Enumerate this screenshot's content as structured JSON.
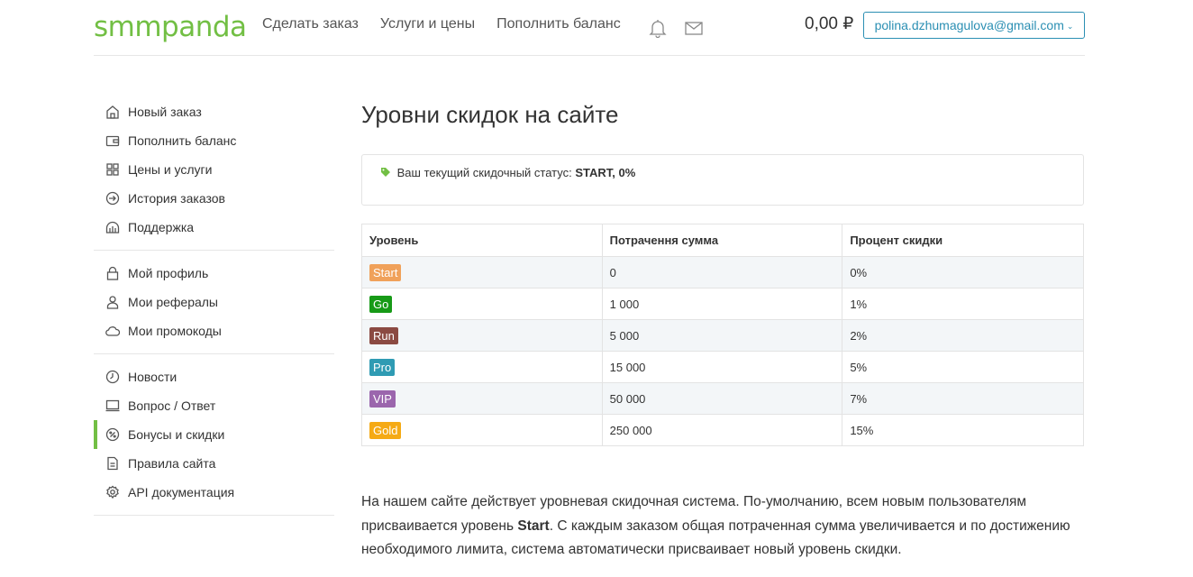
{
  "header": {
    "logo": {
      "part1": "smm",
      "part2": "panda"
    },
    "nav": [
      "Сделать заказ",
      "Услуги и цены",
      "Пополнить баланс"
    ],
    "icons": [
      "bell-icon",
      "envelope-icon"
    ],
    "balance": "0,00 ₽",
    "account": "polina.dzhumagulova@gmail.com"
  },
  "sidebar": {
    "groups": [
      [
        {
          "label": "Новый заказ",
          "icon": "home-icon"
        },
        {
          "label": "Пополнить баланс",
          "icon": "wallet-icon"
        },
        {
          "label": "Цены и услуги",
          "icon": "grid-icon"
        },
        {
          "label": "История заказов",
          "icon": "history-icon"
        },
        {
          "label": "Поддержка",
          "icon": "support-icon"
        }
      ],
      [
        {
          "label": "Мой профиль",
          "icon": "lock-icon"
        },
        {
          "label": "Мои рефералы",
          "icon": "user-icon"
        },
        {
          "label": "Мои промокоды",
          "icon": "cloud-icon"
        }
      ],
      [
        {
          "label": "Новости",
          "icon": "clock-icon"
        },
        {
          "label": "Вопрос / Ответ",
          "icon": "monitor-icon"
        },
        {
          "label": "Бонусы и скидки",
          "icon": "percent-icon",
          "active": true
        },
        {
          "label": "Правила сайта",
          "icon": "document-icon"
        },
        {
          "label": "API документация",
          "icon": "gear-icon"
        }
      ]
    ]
  },
  "main": {
    "title": "Уровни скидок на сайте",
    "status": {
      "label": "Ваш текущий скидочный статус:",
      "value": "START, 0%",
      "icon": "tag-icon",
      "icon_color": "#72bf44"
    },
    "table": {
      "headers": [
        "Уровень",
        "Потрачення сумма",
        "Процент скидки"
      ],
      "rows": [
        {
          "level": "Start",
          "color": "#f0a15a",
          "amount": "0",
          "percent": "0%"
        },
        {
          "level": "Go",
          "color": "#179a17",
          "amount": "1 000",
          "percent": "1%"
        },
        {
          "level": "Run",
          "color": "#8b4a42",
          "amount": "5 000",
          "percent": "2%"
        },
        {
          "level": "Pro",
          "color": "#2f9bb3",
          "amount": "15 000",
          "percent": "5%"
        },
        {
          "level": "VIP",
          "color": "#9b66ad",
          "amount": "50 000",
          "percent": "7%"
        },
        {
          "level": "Gold",
          "color": "#f5aa15",
          "amount": "250 000",
          "percent": "15%"
        }
      ]
    },
    "description": {
      "before": "На нашем сайте действует уровневая скидочная система. По-умолчанию, всем новым пользователям присваивается уровень ",
      "bold": "Start",
      "after": ". С каждым заказом общая потраченная сумма увеличивается и по достижению необходимого лимита, система автоматически присваивает новый уровень скидки."
    }
  }
}
